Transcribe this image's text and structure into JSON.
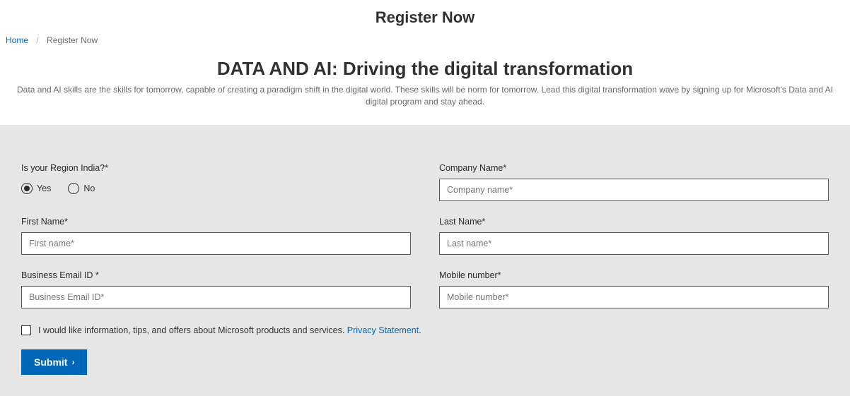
{
  "page": {
    "title": "Register Now"
  },
  "breadcrumb": {
    "home": "Home",
    "sep": "/",
    "current": "Register Now"
  },
  "hero": {
    "headline": "DATA AND AI: Driving the digital transformation",
    "subtext": "Data and AI skills are the skills for tomorrow, capable of creating a paradigm shift in the digital world. These skills will be norm for tomorrow. Lead this digital transformation wave by signing up for Microsoft's Data and AI digital program and stay ahead."
  },
  "form": {
    "region": {
      "label": "Is your Region India?*",
      "options": {
        "yes": "Yes",
        "no": "No"
      }
    },
    "company": {
      "label": "Company Name*",
      "placeholder": "Company name*"
    },
    "first_name": {
      "label": "First Name*",
      "placeholder": "First name*"
    },
    "last_name": {
      "label": "Last Name*",
      "placeholder": "Last name*"
    },
    "email": {
      "label": "Business Email ID *",
      "placeholder": "Business Email ID*"
    },
    "mobile": {
      "label": "Mobile number*",
      "placeholder": "Mobile number*"
    },
    "consent": {
      "text": "I would like information, tips, and offers about Microsoft products and services. ",
      "link_text": "Privacy Statement",
      "dot": "."
    },
    "submit": {
      "label": "Submit",
      "chevron": "›"
    }
  }
}
